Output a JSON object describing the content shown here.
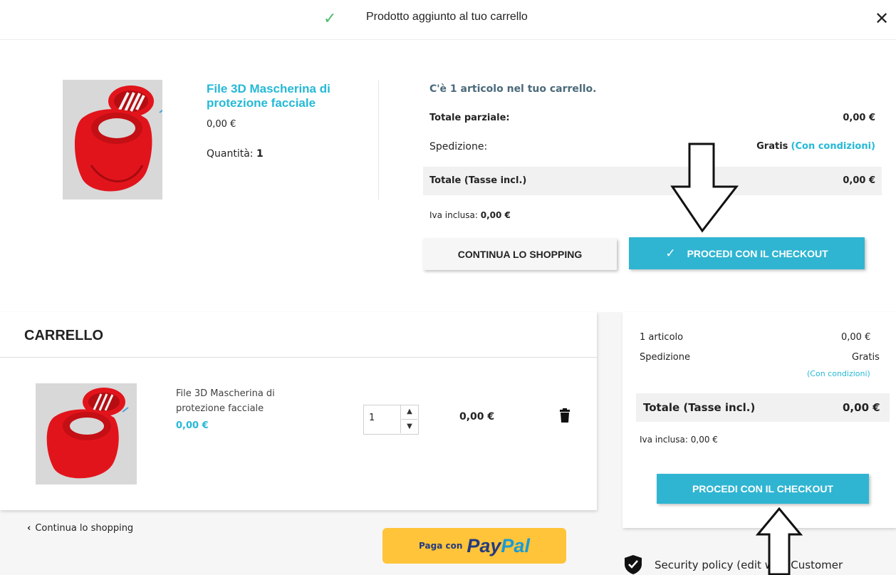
{
  "modal": {
    "header_title": "Prodotto aggiunto al tuo carrello",
    "close_glyph": "✕",
    "check_glyph": "✓",
    "product": {
      "name": "File 3D Mascherina di protezione facciale",
      "price": "0,00 €",
      "quantity_label": "Quantità:",
      "quantity_value": "1"
    },
    "cart_count_text": "C'è 1 articolo nel tuo carrello.",
    "subtotal_label": "Totale parziale:",
    "subtotal_value": "0,00 €",
    "shipping_label": "Spedizione:",
    "shipping_value": "Gratis",
    "shipping_conditions": "(Con condizioni)",
    "total_label": "Totale (Tasse incl.)",
    "total_value": "0,00 €",
    "vat_label": "Iva inclusa:",
    "vat_value": "0,00 €",
    "continue_button": "CONTINUA LO SHOPPING",
    "checkout_button": "PROCEDI CON IL CHECKOUT"
  },
  "cart": {
    "title": "CARRELLO",
    "line": {
      "name": "File 3D Mascherina di protezione facciale",
      "unit_price": "0,00 €",
      "quantity": "1",
      "total": "0,00 €"
    },
    "continue_link": "Continua lo shopping",
    "paypal": {
      "prefix": "Paga con",
      "brand_part1": "Pay",
      "brand_part2": "Pal"
    }
  },
  "summary": {
    "items_label": "1 articolo",
    "items_value": "0,00 €",
    "shipping_label": "Spedizione",
    "shipping_value": "Gratis",
    "shipping_conditions": "(Con condizioni)",
    "total_label": "Totale (Tasse incl.)",
    "total_value": "0,00 €",
    "vat_text": "Iva inclusa: 0,00 €",
    "checkout_button": "PROCEDI CON IL CHECKOUT",
    "security_text": "Security policy (edit with Customer"
  },
  "colors": {
    "accent": "#2fb5d2",
    "link": "#25b9d7",
    "success": "#4cbb6c",
    "paypal_yellow": "#ffc439"
  },
  "icons": [
    "check-icon",
    "close-icon",
    "trash-icon",
    "chevron-left-icon",
    "chevron-up-icon",
    "chevron-down-icon",
    "shield-icon",
    "arrow-down-annotation",
    "arrow-up-annotation"
  ]
}
